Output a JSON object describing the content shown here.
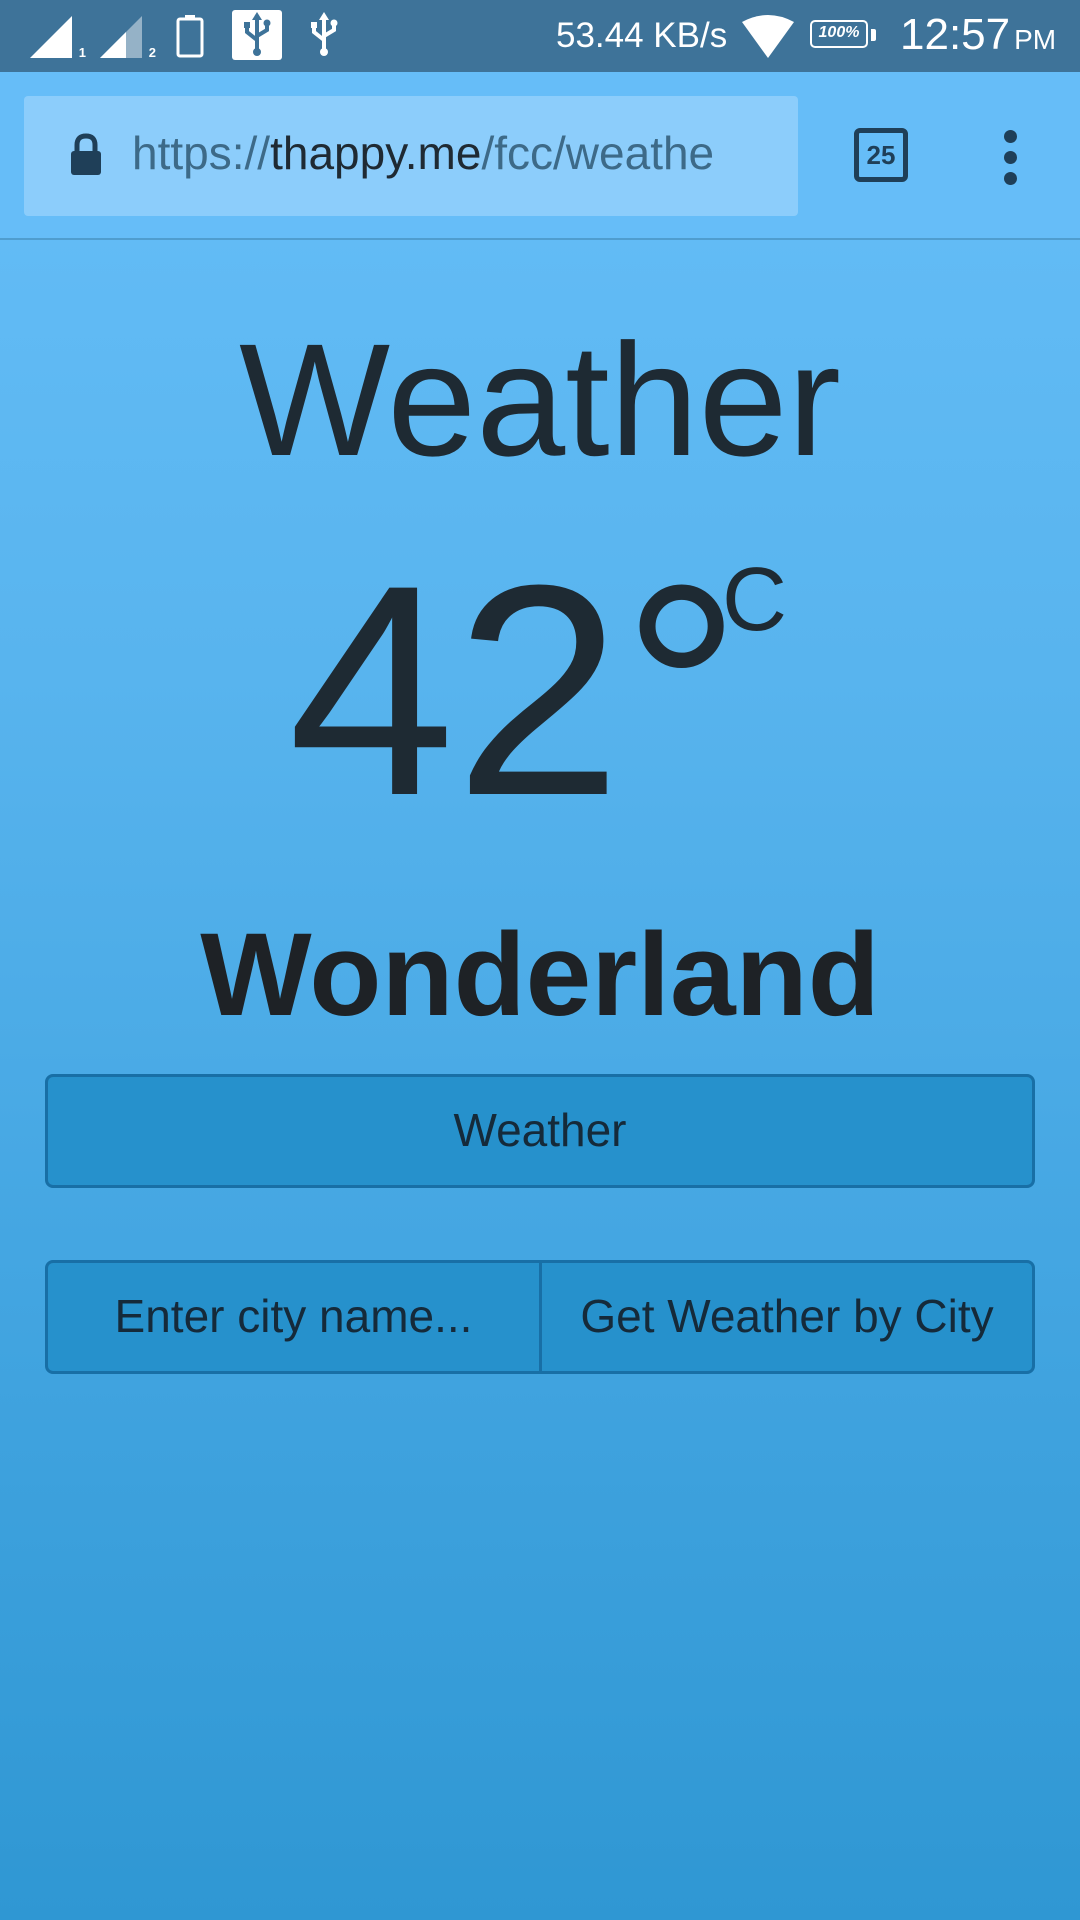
{
  "status_bar": {
    "sim1_label": "1",
    "sim2_label": "2",
    "battery_small_label": "100",
    "network_speed": "53.44 KB/s",
    "battery_percent": "100%",
    "time": "12:57",
    "ampm": "PM",
    "icons": [
      "signal-sim1-icon",
      "signal-sim2-icon",
      "battery-saver-icon",
      "usb-debug-icon",
      "usb-icon",
      "wifi-icon",
      "battery-icon"
    ]
  },
  "browser": {
    "url_scheme": "https://",
    "url_domain": "thappy.me",
    "url_path": "/fcc/weathe",
    "tab_count": "25",
    "icons": [
      "lock-icon",
      "tabs-icon",
      "overflow-menu-icon"
    ]
  },
  "page": {
    "title": "Weather",
    "temperature": "42°",
    "unit": "C",
    "city": "Wonderland",
    "weather_button": "Weather",
    "city_input_placeholder": "Enter city name...",
    "city_button": "Get Weather by City"
  },
  "colors": {
    "status_bar": "#3e7399",
    "toolbar": "#66bdf8",
    "button": "#2691cc",
    "text": "#1e2a33"
  }
}
